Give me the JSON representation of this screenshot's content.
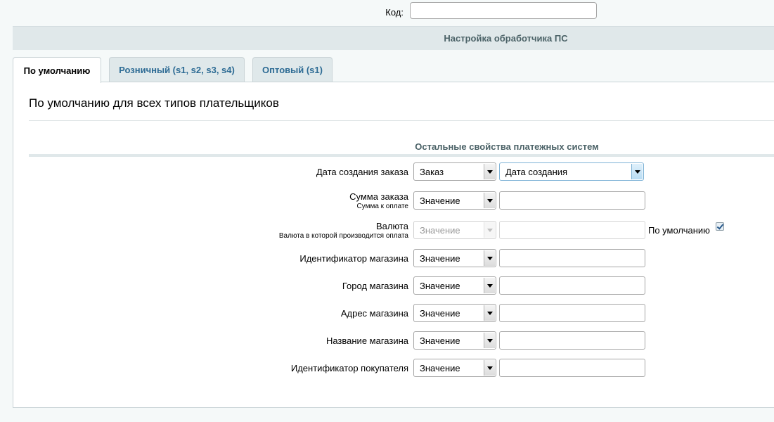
{
  "code": {
    "label": "Код:",
    "value": ""
  },
  "section": {
    "title": "Настройка обработчика ПС"
  },
  "tabs": [
    {
      "label": "По умолчанию",
      "active": true
    },
    {
      "label": "Розничный (s1, s2, s3, s4)",
      "active": false
    },
    {
      "label": "Оптовый (s1)",
      "active": false
    }
  ],
  "panel": {
    "heading": "По умолчанию для всех типов плательщиков",
    "props_heading": "Остальные свойства платежных систем"
  },
  "fields": [
    {
      "label": "Дата создания заказа",
      "sub": "",
      "type": "Заказ",
      "value": "Дата создания"
    },
    {
      "label": "Сумма заказа",
      "sub": "Сумма к оплате",
      "type": "Значение",
      "value": ""
    },
    {
      "label": "Валюта",
      "sub": "Валюта в которой производится оплата",
      "type": "Значение",
      "value": "",
      "default_label": "По умолчанию",
      "default_checked": true
    },
    {
      "label": "Идентификатор магазина",
      "sub": "",
      "type": "Значение",
      "value": ""
    },
    {
      "label": "Город магазина",
      "sub": "",
      "type": "Значение",
      "value": ""
    },
    {
      "label": "Адрес магазина",
      "sub": "",
      "type": "Значение",
      "value": ""
    },
    {
      "label": "Название магазина",
      "sub": "",
      "type": "Значение",
      "value": ""
    },
    {
      "label": "Идентификатор покупателя",
      "sub": "",
      "type": "Значение",
      "value": ""
    }
  ]
}
